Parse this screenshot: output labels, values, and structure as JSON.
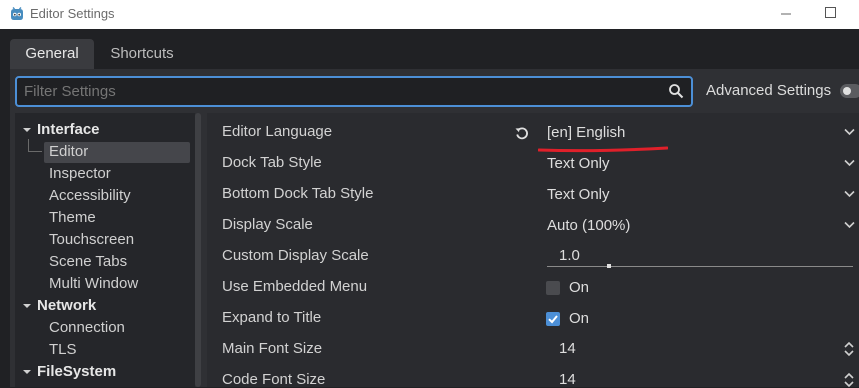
{
  "window": {
    "title": "Editor Settings",
    "app_icon": "godot-icon"
  },
  "tabs": [
    {
      "label": "General",
      "active": true
    },
    {
      "label": "Shortcuts",
      "active": false
    }
  ],
  "search": {
    "placeholder": "Filter Settings",
    "value": ""
  },
  "advanced": {
    "label": "Advanced Settings",
    "enabled": false
  },
  "tree": {
    "sections": [
      {
        "label": "Interface",
        "items": [
          "Editor",
          "Inspector",
          "Accessibility",
          "Theme",
          "Touchscreen",
          "Scene Tabs",
          "Multi Window"
        ]
      },
      {
        "label": "Network",
        "items": [
          "Connection",
          "TLS"
        ]
      },
      {
        "label": "FileSystem",
        "items": []
      }
    ],
    "selected": "Editor"
  },
  "properties": [
    {
      "label": "Editor Language",
      "value": "[en] English",
      "control": "dropdown"
    },
    {
      "label": "Dock Tab Style",
      "value": "Text Only",
      "control": "dropdown"
    },
    {
      "label": "Bottom Dock Tab Style",
      "value": "Text Only",
      "control": "dropdown"
    },
    {
      "label": "Display Scale",
      "value": "Auto (100%)",
      "control": "dropdown"
    },
    {
      "label": "Custom Display Scale",
      "value": "1.0",
      "control": "slider"
    },
    {
      "label": "Use Embedded Menu",
      "value": "On",
      "control": "checkbox",
      "checked": false
    },
    {
      "label": "Expand to Title",
      "value": "On",
      "control": "checkbox",
      "checked": true
    },
    {
      "label": "Main Font Size",
      "value": "14",
      "control": "spinbox"
    },
    {
      "label": "Code Font Size",
      "value": "14",
      "control": "spinbox"
    }
  ],
  "colors": {
    "accent": "#4c8fd6",
    "annotation": "#e0202a"
  }
}
